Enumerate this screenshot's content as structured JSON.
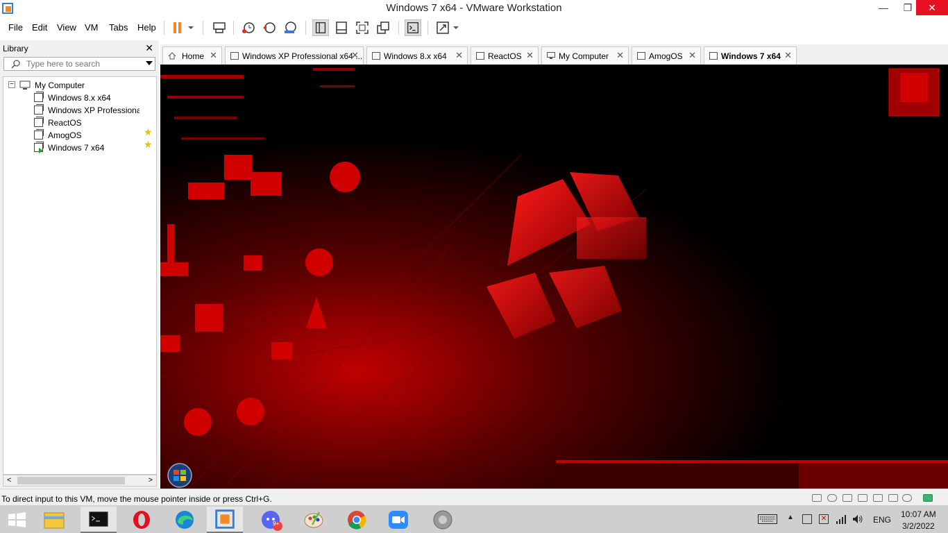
{
  "window": {
    "title": "Windows 7 x64 - VMware Workstation",
    "min_glyph": "—",
    "max_glyph": "❐",
    "close_glyph": "✕"
  },
  "menu": [
    "File",
    "Edit",
    "View",
    "VM",
    "Tabs",
    "Help"
  ],
  "library": {
    "title": "Library",
    "close_glyph": "✕",
    "search_placeholder": "Type here to search",
    "tree": {
      "root": "My Computer",
      "collapse_glyph": "−",
      "items": [
        {
          "label": "Windows 8.x x64",
          "starred": true
        },
        {
          "label": "Windows XP Professiona",
          "starred": true
        },
        {
          "label": "ReactOS",
          "starred": false
        },
        {
          "label": "AmogOS",
          "starred": false
        },
        {
          "label": "Windows 7 x64",
          "starred": false,
          "running": true
        }
      ]
    },
    "scroll_left": "<",
    "scroll_right": ">"
  },
  "tabs": [
    {
      "label": "Home",
      "icon": "home-icon",
      "active": false
    },
    {
      "label": "Windows XP Professional x64 ...",
      "icon": "vm-icon",
      "active": false
    },
    {
      "label": "Windows 8.x x64",
      "icon": "vm-icon",
      "active": false
    },
    {
      "label": "ReactOS",
      "icon": "vm-icon",
      "active": false
    },
    {
      "label": "My Computer",
      "icon": "computer-icon",
      "active": false
    },
    {
      "label": "AmogOS",
      "icon": "vm-icon",
      "active": false
    },
    {
      "label": "Windows 7 x64",
      "icon": "vm-running-icon",
      "active": true
    }
  ],
  "tab_close_glyph": "✕",
  "status": {
    "text": "To direct input to this VM, move the mouse pointer inside or press Ctrl+G."
  },
  "taskbar": {
    "apps": [
      "start",
      "file-explorer",
      "terminal",
      "opera",
      "edge",
      "vmware",
      "discord",
      "paint",
      "chrome",
      "zoom",
      "speaker"
    ],
    "discord_badge": "9+",
    "lang": "ENG",
    "time": "10:07 AM",
    "date": "3/2/2022"
  },
  "colors": {
    "accent_red": "#e00000",
    "taskbar": "#cfcfcf",
    "close_red": "#e81123",
    "pause_orange": "#f08a24"
  }
}
